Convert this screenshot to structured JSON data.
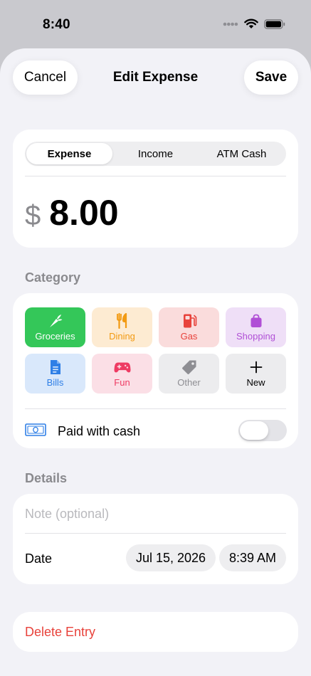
{
  "status": {
    "time": "8:40"
  },
  "header": {
    "title": "Edit Expense",
    "cancel_label": "Cancel",
    "save_label": "Save"
  },
  "type_tabs": [
    {
      "label": "Expense",
      "active": true
    },
    {
      "label": "Income",
      "active": false
    },
    {
      "label": "ATM Cash",
      "active": false
    }
  ],
  "amount": {
    "currency": "$",
    "value": "8.00"
  },
  "category": {
    "section_label": "Category",
    "items": [
      {
        "label": "Groceries",
        "icon": "carrot-icon",
        "bg": "#34c759",
        "fg": "#ffffff",
        "selected": true
      },
      {
        "label": "Dining",
        "icon": "fork-knife-icon",
        "bg": "#fdebd2",
        "fg": "#f29a12",
        "selected": false
      },
      {
        "label": "Gas",
        "icon": "fuel-pump-icon",
        "bg": "#fadcdc",
        "fg": "#e8423b",
        "selected": false
      },
      {
        "label": "Shopping",
        "icon": "shopping-bag-icon",
        "bg": "#efdff7",
        "fg": "#b04fd6",
        "selected": false
      },
      {
        "label": "Bills",
        "icon": "document-icon",
        "bg": "#d9e8fb",
        "fg": "#2f7fe6",
        "selected": false
      },
      {
        "label": "Fun",
        "icon": "gamepad-icon",
        "bg": "#fbdfe6",
        "fg": "#ee3b63",
        "selected": false
      },
      {
        "label": "Other",
        "icon": "tag-icon",
        "bg": "#ececee",
        "fg": "#8e8e93",
        "selected": false
      },
      {
        "label": "New",
        "icon": "plus-icon",
        "bg": "#ececee",
        "fg": "#000000",
        "selected": false
      }
    ],
    "cash": {
      "label": "Paid with cash",
      "on": false
    }
  },
  "details": {
    "section_label": "Details",
    "note_placeholder": "Note (optional)",
    "note_value": "",
    "date_label": "Date",
    "date_value": "Jul 15, 2026",
    "time_value": "8:39 AM"
  },
  "delete_label": "Delete Entry",
  "colors": {
    "accent_green": "#34c759",
    "destructive": "#e8423b",
    "background": "#f2f2f7"
  }
}
